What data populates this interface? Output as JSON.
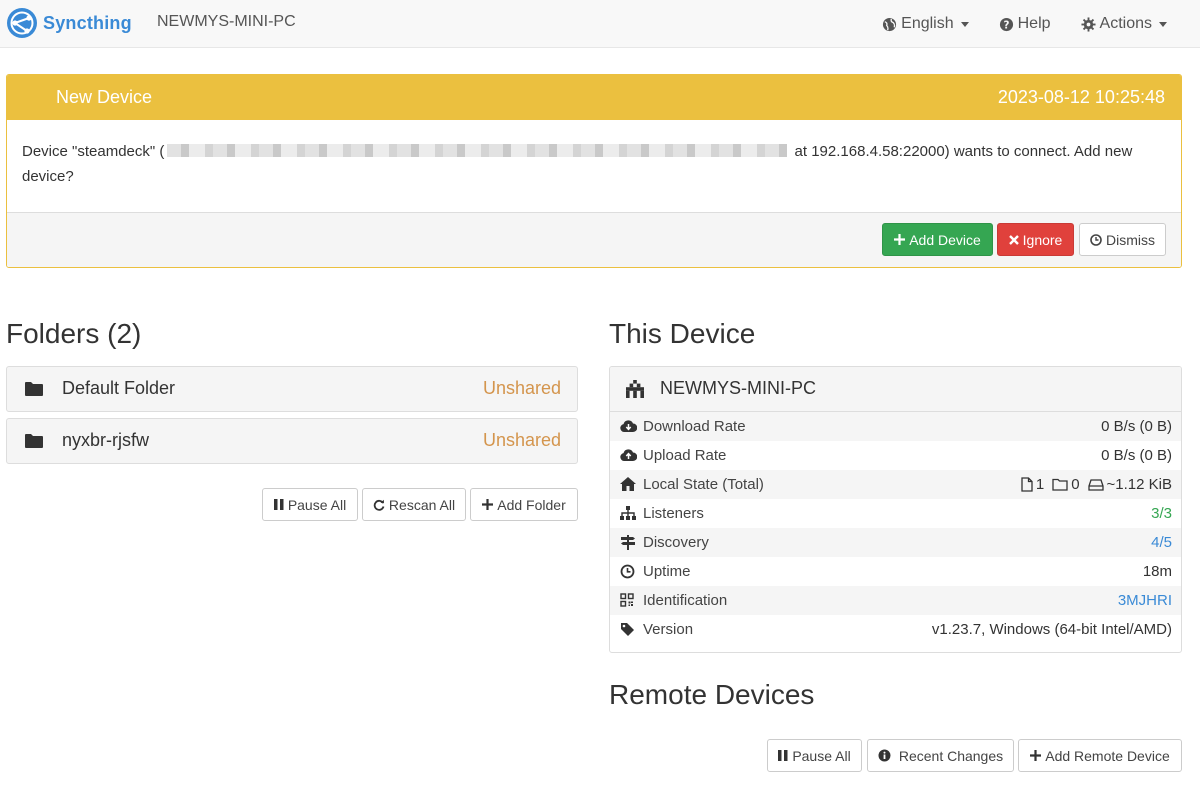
{
  "navbar": {
    "brand": "Syncthing",
    "device_name": "NEWMYS-MINI-PC",
    "language": "English",
    "help": "Help",
    "actions": "Actions"
  },
  "notification": {
    "title": "New Device",
    "timestamp": "2023-08-12 10:25:48",
    "message_prefix": "Device \"steamdeck\" (",
    "message_suffix": " at 192.168.4.58:22000) wants to connect. Add new device?",
    "buttons": {
      "add": "Add Device",
      "ignore": "Ignore",
      "dismiss": "Dismiss"
    }
  },
  "folders": {
    "heading": "Folders (2)",
    "items": [
      {
        "name": "Default Folder",
        "state": "Unshared"
      },
      {
        "name": "nyxbr-rjsfw",
        "state": "Unshared"
      }
    ],
    "buttons": {
      "pause_all": "Pause All",
      "rescan_all": "Rescan All",
      "add_folder": "Add Folder"
    }
  },
  "this_device": {
    "heading": "This Device",
    "name": "NEWMYS-MINI-PC",
    "rows": {
      "download": {
        "label": "Download Rate",
        "value": "0 B/s (0 B)"
      },
      "upload": {
        "label": "Upload Rate",
        "value": "0 B/s (0 B)"
      },
      "local_state": {
        "label": "Local State (Total)",
        "files": "1",
        "dirs": "0",
        "size": "~1.12 KiB"
      },
      "listeners": {
        "label": "Listeners",
        "value": "3/3"
      },
      "discovery": {
        "label": "Discovery",
        "value": "4/5"
      },
      "uptime": {
        "label": "Uptime",
        "value": "18m"
      },
      "identification": {
        "label": "Identification",
        "value": "3MJHRI"
      },
      "version": {
        "label": "Version",
        "value": "v1.23.7, Windows (64-bit Intel/AMD)"
      }
    }
  },
  "remote_devices": {
    "heading": "Remote Devices",
    "buttons": {
      "pause_all": "Pause All",
      "recent_changes": "Recent Changes",
      "add_remote": "Add Remote Device"
    }
  },
  "colors": {
    "brand_blue": "#3a8ad6",
    "warning": "#ebc03f",
    "success": "#35a652",
    "danger": "#e0413c",
    "unshared": "#d4954d"
  }
}
